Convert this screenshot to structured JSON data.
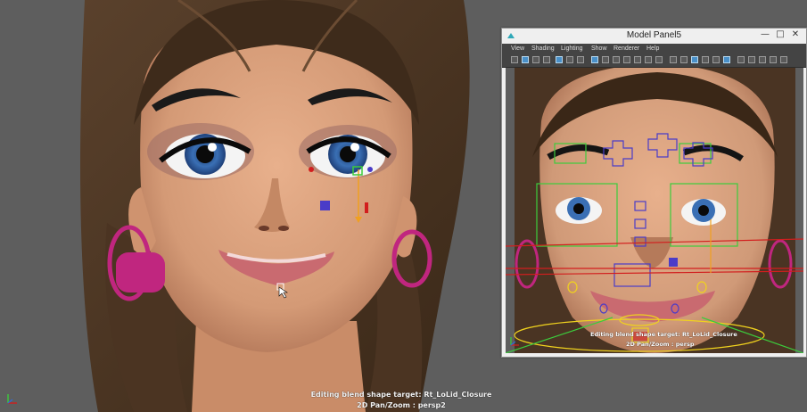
{
  "main_viewport": {
    "hud_line1": "Editing blend shape target: Rt_LoLid_Closure",
    "hud_line2": "2D Pan/Zoom : persp2"
  },
  "model_panel": {
    "title": "Model Panel5",
    "menu": [
      "View",
      "Shading",
      "Lighting",
      "Show",
      "Renderer",
      "Help"
    ],
    "hud_line1": "Editing blend shape target: Rt_LoLid_Closure",
    "hud_line2": "2D Pan/Zoom : persp",
    "window_buttons": {
      "minimize": "—",
      "maximize": "□",
      "close": "✕"
    }
  },
  "colors": {
    "viewport_bg": "#5e5e5e",
    "skin": "#d9a27e",
    "hair": "#4a3423",
    "earring": "#c0267f",
    "control_blue": "#4a3cc8",
    "control_red": "#d21e1e",
    "control_yellow": "#f0d21e",
    "control_green": "#3ccc3c"
  }
}
